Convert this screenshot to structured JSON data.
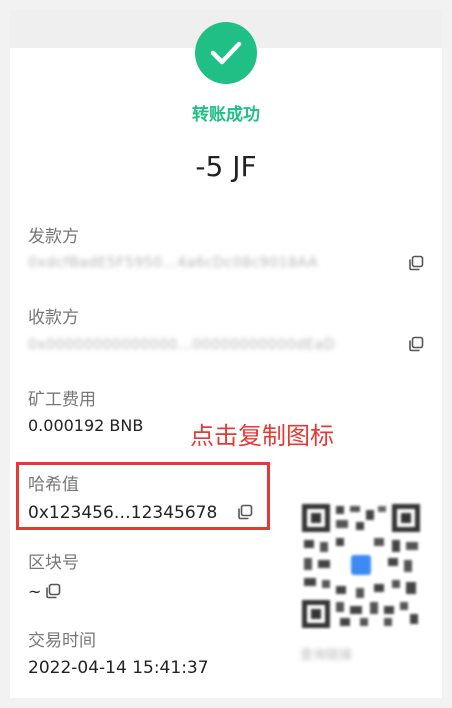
{
  "transfer": {
    "status": "转账成功",
    "amount": "-5 JF"
  },
  "fields": {
    "from_label": "发款方",
    "from_value": "0xdcfBadE5F5950…4a6cDc08c9018AA",
    "to_label": "收款方",
    "to_value": "0x00000000000000…00000000000dEaD",
    "fee_label": "矿工费用",
    "fee_value": "0.000192 BNB",
    "hash_label": "哈希值",
    "hash_value": "0x123456…12345678",
    "block_label": "区块号",
    "block_value": "~",
    "time_label": "交易时间",
    "time_value": "2022-04-14 15:41:37"
  },
  "annotation": {
    "text": "点击复制图标",
    "color": "#e53935"
  },
  "qr": {
    "caption": "查询链接"
  },
  "colors": {
    "success": "#1fbf86",
    "annotation": "#e53935"
  },
  "icons": [
    "check-icon",
    "copy-icon",
    "qr-code"
  ]
}
